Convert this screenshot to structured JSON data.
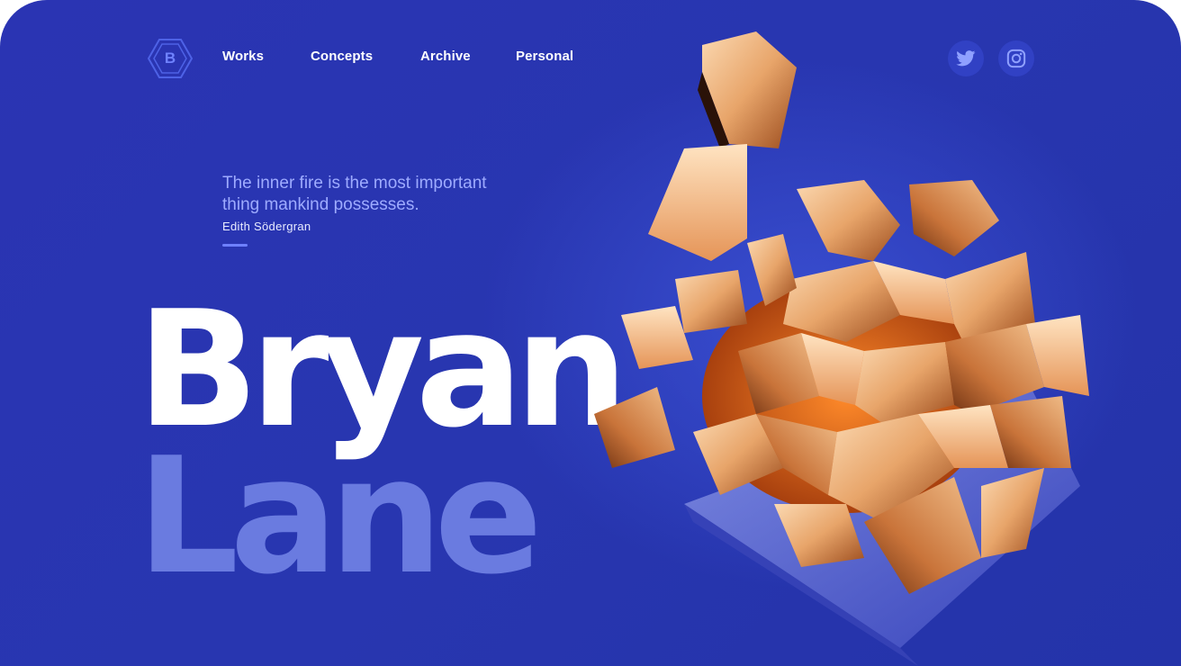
{
  "brand": {
    "logo_letter": "B"
  },
  "nav": {
    "items": [
      {
        "label": "Works"
      },
      {
        "label": "Concepts"
      },
      {
        "label": "Archive"
      },
      {
        "label": "Personal"
      }
    ]
  },
  "social": {
    "twitter_icon": "twitter-icon",
    "instagram_icon": "instagram-icon"
  },
  "hero": {
    "quote": "The inner fire is the most important thing mankind possesses.",
    "author": "Edith Södergran",
    "first_name": "Bryan",
    "last_name": "Lane"
  },
  "colors": {
    "background": "#2a34b3",
    "accent": "#6e80ff",
    "quote_text": "#9eabff",
    "last_name": "#6a7be0",
    "copper": "#e08a4a"
  }
}
